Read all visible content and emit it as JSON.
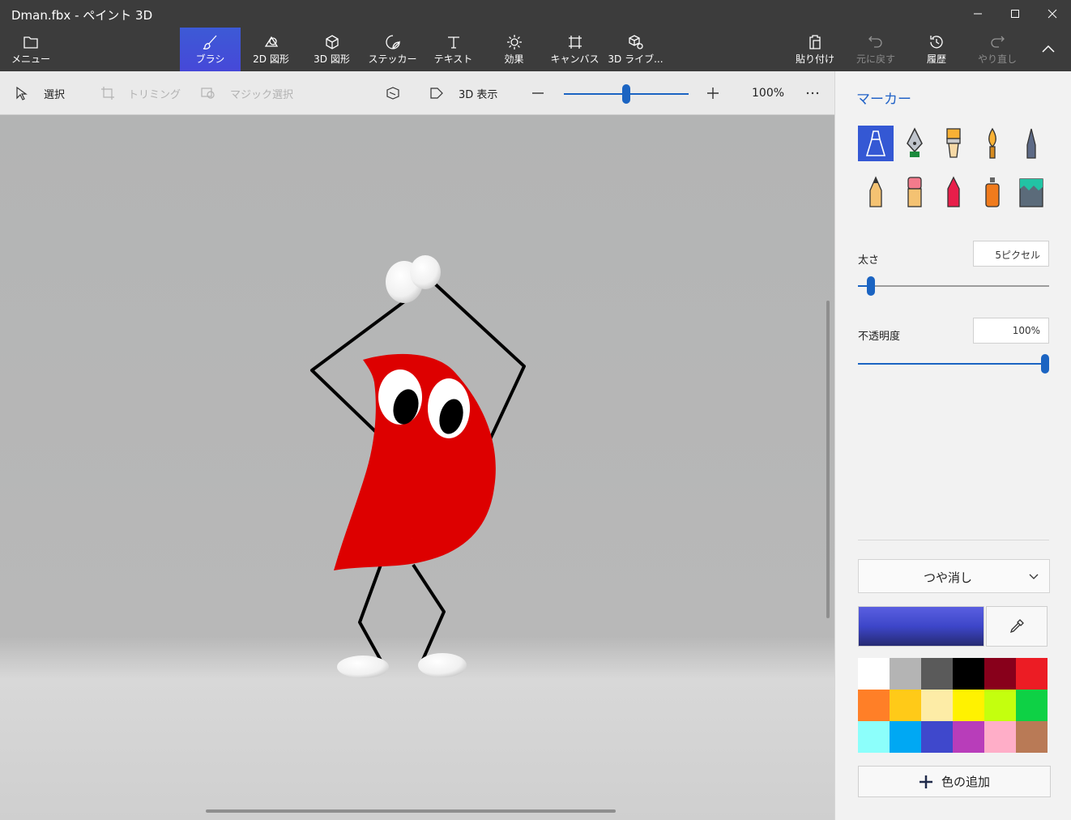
{
  "window": {
    "title": "Dman.fbx - ペイント 3D"
  },
  "toolbar": {
    "menu": "メニュー",
    "brush": "ブラシ",
    "shapes2d": "2D 図形",
    "shapes3d": "3D 図形",
    "sticker": "ステッカー",
    "text": "テキスト",
    "effects": "効果",
    "canvas": "キャンバス",
    "library3d": "3D ライブ...",
    "paste": "貼り付け",
    "undo": "元に戻す",
    "history": "履歴",
    "redo": "やり直し"
  },
  "subbar": {
    "select": "選択",
    "crop": "トリミング",
    "magic_select": "マジック選択",
    "view3d": "3D 表示",
    "zoom": "100%",
    "zoom_fraction": 0.5
  },
  "side": {
    "title": "マーカー",
    "brushes": [
      "marker-icon",
      "calligraphy-pen-icon",
      "oil-brush-icon",
      "watercolor-icon",
      "pixel-pen-icon",
      "pencil-icon",
      "eraser-icon",
      "crayon-icon",
      "spray-can-icon",
      "fill-bucket-icon"
    ],
    "thickness_label": "太さ",
    "thickness_value": "5ピクセル",
    "thickness_fraction": 0.05,
    "opacity_label": "不透明度",
    "opacity_value": "100%",
    "opacity_fraction": 1.0,
    "finish": "つや消し",
    "current_color": "#3d46c9",
    "palette": [
      "#ffffff",
      "#b4b4b4",
      "#5a5a5a",
      "#000000",
      "#88001b",
      "#ec1c24",
      "#ff7f27",
      "#ffca18",
      "#fdeca6",
      "#fff200",
      "#c4ff0e",
      "#0ed145",
      "#8cfffb",
      "#00a8f3",
      "#3f48cc",
      "#b83dba",
      "#ffaec8",
      "#b97a56"
    ],
    "add_color": "色の追加"
  },
  "colors": {
    "accent": "#2263c7",
    "character_red": "#dd0000"
  }
}
